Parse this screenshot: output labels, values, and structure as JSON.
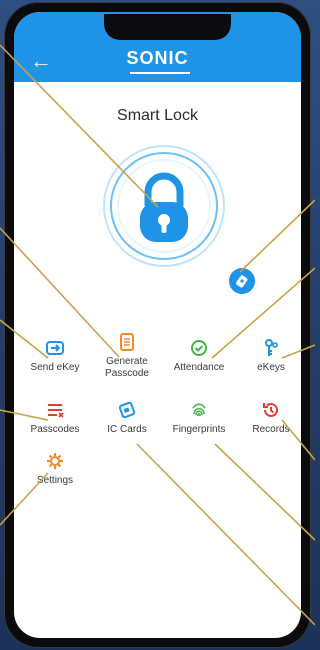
{
  "app": {
    "brand": "SONIC",
    "title": "Smart Lock"
  },
  "menu": {
    "items": [
      {
        "label": "Send eKey",
        "icon": "send-ekey-icon"
      },
      {
        "label": "Generate Passcode",
        "icon": "generate-passcode-icon"
      },
      {
        "label": "Attendance",
        "icon": "attendance-icon"
      },
      {
        "label": "eKeys",
        "icon": "ekeys-icon"
      },
      {
        "label": "Passcodes",
        "icon": "passcodes-icon"
      },
      {
        "label": "IC Cards",
        "icon": "ic-cards-icon"
      },
      {
        "label": "Fingerprints",
        "icon": "fingerprints-icon"
      },
      {
        "label": "Records",
        "icon": "records-icon"
      },
      {
        "label": "Settings",
        "icon": "settings-icon"
      }
    ]
  },
  "colors": {
    "accent": "#1f93e6",
    "background": "#2f4f82",
    "callout_line": "#c9a34a"
  }
}
